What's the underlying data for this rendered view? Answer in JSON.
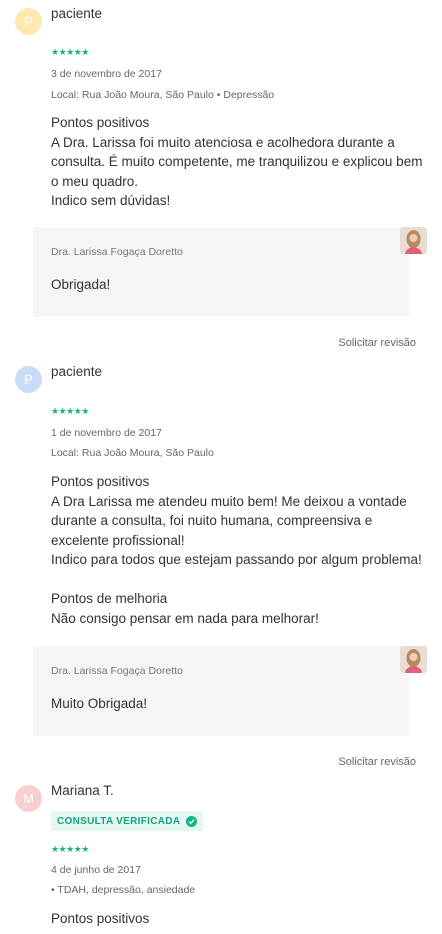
{
  "reviews": [
    {
      "avatar_letter": "P",
      "author": "paciente",
      "stars": "★★★★★",
      "date": "3 de novembro de 2017",
      "location": "Local: Rua João Moura, São Paulo • Depressão",
      "body_lines": [
        "Pontos positivos",
        "A Dra. Larissa foi muito atenciosa e acolhedora durante a",
        "consulta. É muito competente, me tranquilizou e explicou bem",
        "o meu quadro.",
        "Indico sem dúvidas!"
      ],
      "reply": {
        "name": "Dra. Larissa Fogaça Doretto",
        "text": "Obrigada!"
      },
      "request_revision": "Solicitar revisão"
    },
    {
      "avatar_letter": "P",
      "author": "paciente",
      "stars": "★★★★★",
      "date": "1 de novembro de 2017",
      "location": "Local: Rua João Moura, São Paulo",
      "body_lines": [
        "Pontos positivos",
        "A Dra Larissa me atendeu muito bem! Me deixou a vontade",
        "durante a consulta, foi nuito humana, compreensiva e",
        "excelente profissional!",
        "Indico para todos que estejam passando por algum problema!",
        "",
        "Pontos de melhoria",
        "Não consigo pensar em nada para melhorar!"
      ],
      "reply": {
        "name": "Dra. Larissa Fogaça Doretto",
        "text": "Muito Obrigada!"
      },
      "request_revision": "Solicitar revisão"
    },
    {
      "avatar_letter": "M",
      "author": "Mariana T.",
      "badge": "CONSULTA VERIFICADA",
      "stars": "★★★★★",
      "date": "4 de junho de 2017",
      "location": "• TDAH, depressão, ansiedade",
      "body_lines": [
        "Pontos positivos"
      ]
    }
  ],
  "colors": {
    "star": "#19b28a",
    "avatar_yellow": "#fde9b0",
    "avatar_blue": "#c9dcf7",
    "avatar_pink": "#f7cfd0",
    "reply_bg": "#f5f5f5",
    "badge_bg": "#e4f7f1"
  },
  "icons": {
    "verified": "check-circle-icon",
    "doctor_photo": "doctor-avatar"
  }
}
